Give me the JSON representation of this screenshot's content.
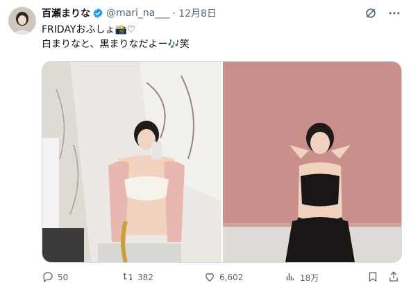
{
  "tweet": {
    "display_name": "百瀬まりな",
    "handle": "@mari_na___",
    "date": "· 12月8日",
    "text_line1": "FRIDAYおふしょ📸♡",
    "text_line2": "白まりなと、黒まりなだよー🎶笑"
  },
  "actions": {
    "replies": "50",
    "retweets": "382",
    "likes": "6,602",
    "views": "18万"
  },
  "icons": [
    "verified-badge-icon",
    "grok-icon",
    "more-icon",
    "reply-icon",
    "retweet-icon",
    "like-icon",
    "views-icon",
    "bookmark-icon",
    "share-icon"
  ],
  "colors": {
    "verified": "#1d9bf0",
    "text_secondary": "#536471",
    "border": "#cfd9de",
    "wall_pink": "#c98f8a"
  }
}
